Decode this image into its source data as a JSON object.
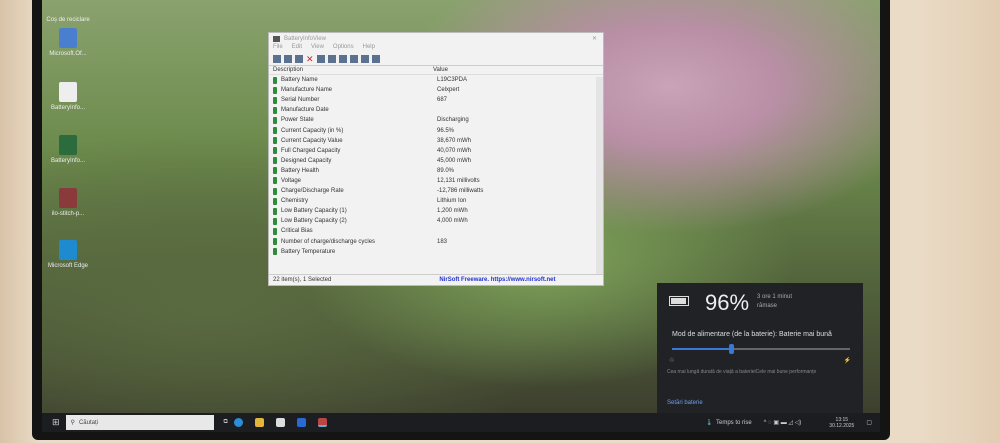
{
  "desktop": {
    "icons": [
      {
        "label": "Coș de reciclare"
      },
      {
        "label": "Microsoft.Of..."
      },
      {
        "label": "BatteryInfo..."
      },
      {
        "label": "BatteryInfo..."
      },
      {
        "label": "ilo-stitch-p..."
      },
      {
        "label": "Microsoft Edge"
      }
    ]
  },
  "window": {
    "title": "BatteryInfoView",
    "menu": [
      "File",
      "Edit",
      "View",
      "Options",
      "Help"
    ],
    "columns": [
      "Description",
      "Value"
    ],
    "rows": [
      {
        "d": "Battery Name",
        "v": "L19C3PDA"
      },
      {
        "d": "Manufacture Name",
        "v": "Celxpert"
      },
      {
        "d": "Serial Number",
        "v": "687"
      },
      {
        "d": "Manufacture Date",
        "v": ""
      },
      {
        "d": "Power State",
        "v": "Discharging"
      },
      {
        "d": "Current Capacity (in %)",
        "v": "96.5%"
      },
      {
        "d": "Current Capacity Value",
        "v": "38,670 mWh"
      },
      {
        "d": "Full Charged Capacity",
        "v": "40,070 mWh"
      },
      {
        "d": "Designed Capacity",
        "v": "45,000 mWh"
      },
      {
        "d": "Battery Health",
        "v": "89.0%"
      },
      {
        "d": "Voltage",
        "v": "12,131 millivolts"
      },
      {
        "d": "Charge/Discharge Rate",
        "v": "-12,786 milliwatts"
      },
      {
        "d": "Chemistry",
        "v": "Lithium Ion"
      },
      {
        "d": "Low Battery Capacity (1)",
        "v": "1,200 mWh"
      },
      {
        "d": "Low Battery Capacity (2)",
        "v": "4,000 mWh"
      },
      {
        "d": "Critical Bias",
        "v": ""
      },
      {
        "d": "Number of charge/discharge cycles",
        "v": "183"
      },
      {
        "d": "Battery Temperature",
        "v": ""
      }
    ],
    "status": "22 item(s), 1 Selected",
    "link": "NirSoft Freeware. https://www.nirsoft.net"
  },
  "flyout": {
    "percent": "96%",
    "remaining": "3 ore 1 minut",
    "remaining2": "rămase",
    "mode": "Mod de alimentare (de la baterie): Baterie mai bună",
    "slider_value": 0.33,
    "left_label": "Cea mai lungă durată de viață a bateriei",
    "right_label": "Cele mai bune performanțe",
    "settings": "Setări baterie"
  },
  "taskbar": {
    "search": "Căutați",
    "weather": "Temps to rise",
    "time": "13:15",
    "date": "30.12.2025"
  }
}
